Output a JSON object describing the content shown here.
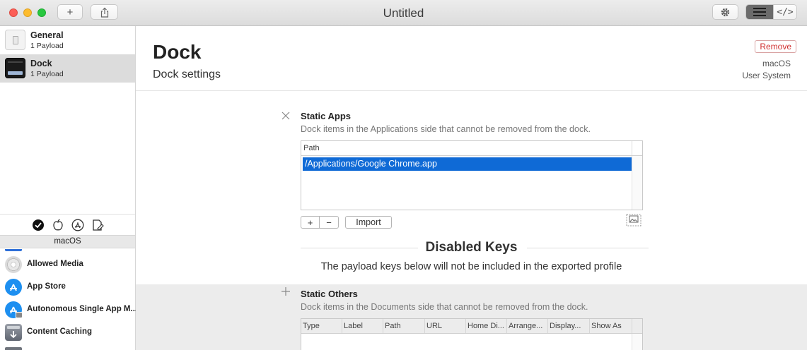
{
  "window": {
    "title": "Untitled",
    "add_label": "+",
    "share_icon": "share-icon",
    "settings_icon": "gear-icon",
    "view_list_icon": "list-icon",
    "view_code_label": "</>"
  },
  "sidebar": {
    "payloads": [
      {
        "name": "General",
        "count": "1 Payload",
        "icon": "general-icon"
      },
      {
        "name": "Dock",
        "count": "1 Payload",
        "icon": "dock-icon"
      }
    ],
    "filters": [
      "checkmark-filter-icon",
      "apple-filter-icon",
      "app-store-filter-icon",
      "document-filter-icon"
    ],
    "platform": "macOS",
    "library": [
      {
        "name": "Allowed Media",
        "icon": "disc-icon"
      },
      {
        "name": "App Store",
        "icon": "app-store-icon"
      },
      {
        "name": "Autonomous Single App M...",
        "icon": "app-store-lock-icon"
      },
      {
        "name": "Content Caching",
        "icon": "caching-icon"
      }
    ]
  },
  "main": {
    "title": "Dock",
    "subtitle": "Dock settings",
    "remove_label": "Remove",
    "platform": "macOS",
    "scope": "User System",
    "static_apps": {
      "title": "Static Apps",
      "description": "Dock items in the Applications side that cannot be removed from the dock.",
      "column": "Path",
      "rows": [
        "/Applications/Google Chrome.app"
      ],
      "add_label": "+",
      "remove_label": "−",
      "import_label": "Import"
    },
    "disabled": {
      "title": "Disabled Keys",
      "description": "The payload keys below will not be included in the exported profile"
    },
    "static_others": {
      "title": "Static Others",
      "description": "Dock items in the Documents side that cannot be removed from the dock.",
      "columns": [
        "Type",
        "Label",
        "Path",
        "URL",
        "Home Di...",
        "Arrange...",
        "Display...",
        "Show As"
      ]
    }
  },
  "colors": {
    "selection": "#0f6ad6",
    "remove": "#d02f2f",
    "selected_sidebar": "#dcdcdc",
    "disabled_bg": "#ececec"
  }
}
